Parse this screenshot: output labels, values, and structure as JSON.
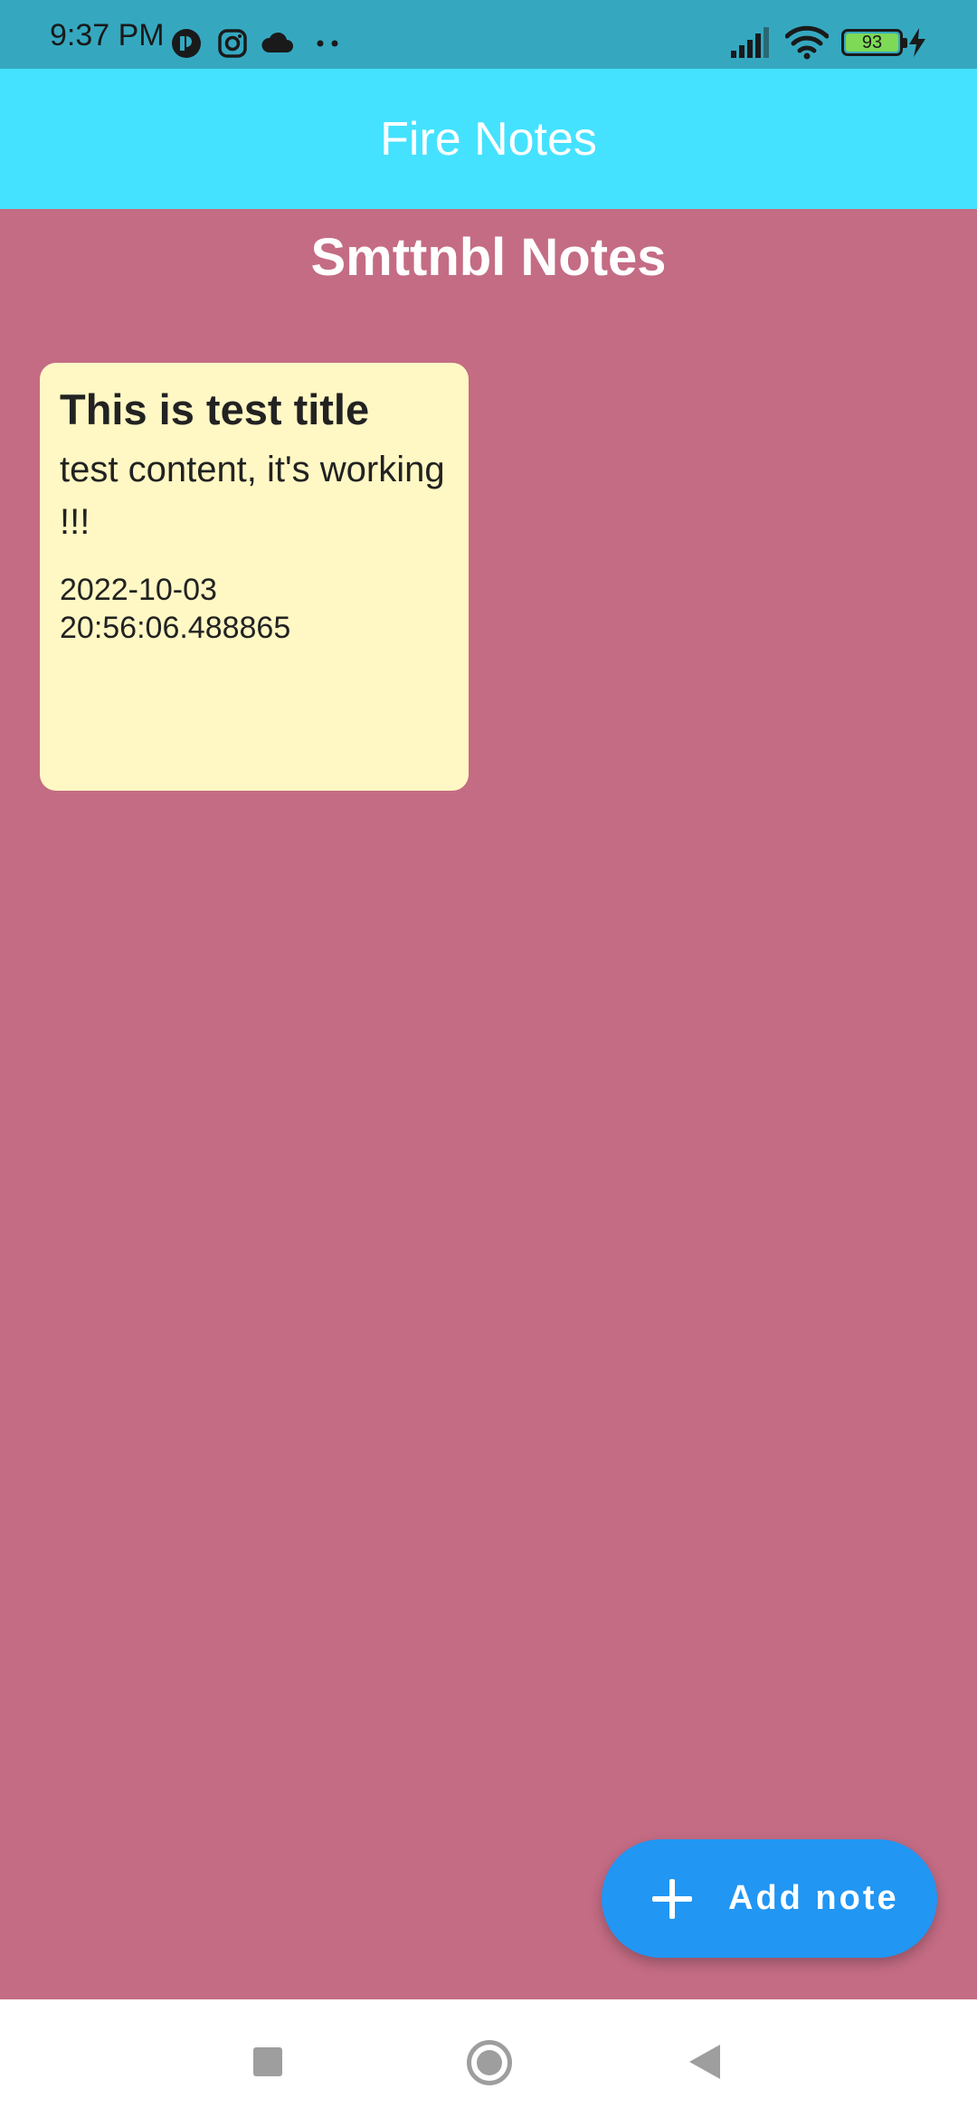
{
  "status_bar": {
    "time": "9:37 PM",
    "battery_level": "93",
    "icons": [
      "sync-app-icon",
      "instagram-icon",
      "cloud-icon",
      "more-dots-icon",
      "signal-icon",
      "wifi-icon",
      "battery-icon",
      "charging-bolt-icon"
    ]
  },
  "app_bar": {
    "title": "Fire Notes"
  },
  "page": {
    "heading": "Smttnbl Notes"
  },
  "notes": [
    {
      "title": "This is test title",
      "content": "test content, it's working !!!",
      "date": "2022-10-03 20:56:06.488865"
    }
  ],
  "fab": {
    "label": "Add note",
    "icon": "plus-icon"
  },
  "nav_bar": {
    "icons": [
      "recent-apps-icon",
      "home-icon",
      "back-icon"
    ]
  },
  "colors": {
    "status_bar": "#35a8c0",
    "app_bar": "#44e2ff",
    "background": "#c46c84",
    "note_card": "#fff8c4",
    "fab": "#2196f3",
    "battery_fill": "#7ed957"
  }
}
